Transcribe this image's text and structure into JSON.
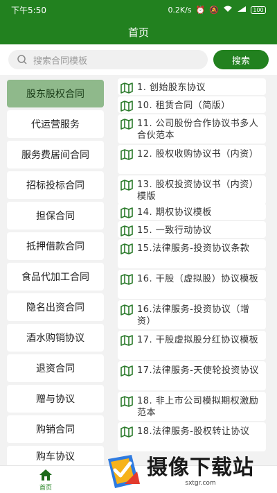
{
  "status_bar": {
    "time": "下午5:50",
    "speed": "0.2K/s",
    "battery": "100"
  },
  "header": {
    "title": "首页"
  },
  "search": {
    "placeholder": "搜索合同模板",
    "button_label": "搜索"
  },
  "sidebar": {
    "active_index": 0,
    "items": [
      {
        "label": "股东股权合同"
      },
      {
        "label": "代运营服务"
      },
      {
        "label": "服务费居间合同"
      },
      {
        "label": "招标投标合同"
      },
      {
        "label": "担保合同"
      },
      {
        "label": "抵押借款合同"
      },
      {
        "label": "食品代加工合同"
      },
      {
        "label": "隐名出资合同"
      },
      {
        "label": "酒水购销协议"
      },
      {
        "label": "退资合同"
      },
      {
        "label": "赠与协议"
      },
      {
        "label": "购销合同"
      },
      {
        "label": "购车协议"
      }
    ]
  },
  "templates": [
    {
      "label": "1. 创始股东协议"
    },
    {
      "label": "10. 租赁合同（简版）"
    },
    {
      "label": "11. 公司股份合作协议书多人合伙范本"
    },
    {
      "label": "12. 股权收购协议书（内资）"
    },
    {
      "label": "13. 股权投资协议书（内资）模版"
    },
    {
      "label": "14. 期权协议模板"
    },
    {
      "label": "15. 一致行动协议"
    },
    {
      "label": "15.法律服务-投资协议条款"
    },
    {
      "label": "16. 干股（虚拟股）协议模板"
    },
    {
      "label": "16.法律服务-投资协议（增资）"
    },
    {
      "label": "17. 干股虚拟股分红协议模板"
    },
    {
      "label": "17.法律服务-天使轮投资协议"
    },
    {
      "label": "18. 非上市公司模拟期权激励范本"
    },
    {
      "label": "18.法律服务-股权转让协议"
    }
  ],
  "tab_bar": {
    "home_label": "首页"
  },
  "watermark": {
    "main": "摄像下载站",
    "sub": "sxtgr.com"
  },
  "colors": {
    "brand_green": "#22811f",
    "active_category": "#8fb98b"
  },
  "icons": {
    "template_item": "book-map-icon",
    "search": "search-icon",
    "home": "home-icon"
  }
}
